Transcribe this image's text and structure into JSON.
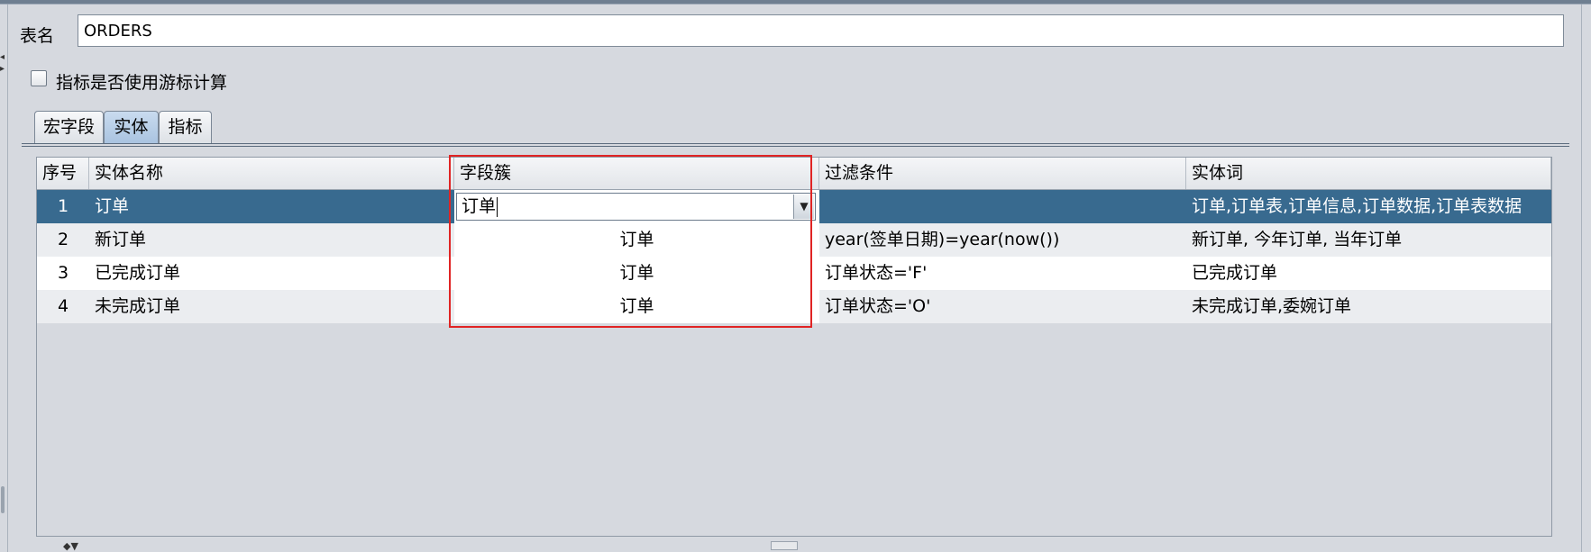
{
  "table_name": {
    "label": "表名",
    "value": "ORDERS"
  },
  "cursor_option": {
    "label": "指标是否使用游标计算",
    "checked": false
  },
  "tabs": [
    {
      "label": "宏字段",
      "selected": false
    },
    {
      "label": "实体",
      "selected": true
    },
    {
      "label": "指标",
      "selected": false
    }
  ],
  "entity_table": {
    "columns": [
      "序号",
      "实体名称",
      "字段簇",
      "过滤条件",
      "实体词"
    ],
    "rows": [
      {
        "index": "1",
        "name": "订单",
        "field_cluster": "订单",
        "filter": "",
        "words": "订单,订单表,订单信息,订单数据,订单表数据",
        "selected": true
      },
      {
        "index": "2",
        "name": "新订单",
        "field_cluster": "订单",
        "filter": "year(签单日期)=year(now())",
        "words": "新订单, 今年订单, 当年订单"
      },
      {
        "index": "3",
        "name": "已完成订单",
        "field_cluster": "订单",
        "filter": "订单状态='F'",
        "words": "已完成订单"
      },
      {
        "index": "4",
        "name": "未完成订单",
        "field_cluster": "订单",
        "filter": "订单状态='O'",
        "words": "未完成订单,委婉订单"
      }
    ]
  },
  "combo": {
    "value": "订单",
    "dropdown_icon": "triangle-down-icon"
  },
  "colors": {
    "selected_row": "#386a8f",
    "highlight_border": "#e02424",
    "tab_selected": "#a9c3e0"
  }
}
